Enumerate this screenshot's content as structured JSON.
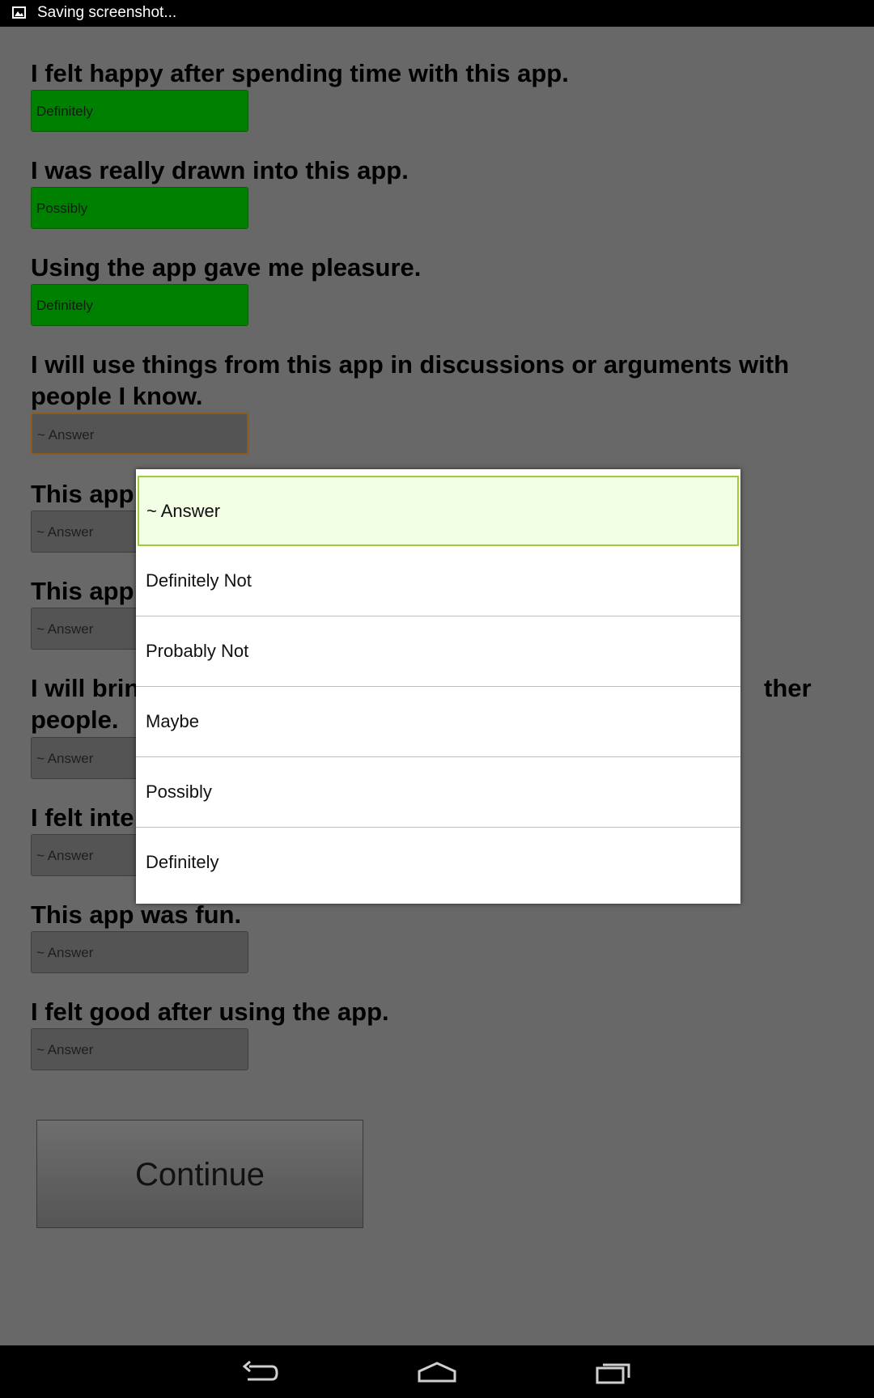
{
  "status_bar": {
    "notification_text": "Saving screenshot..."
  },
  "questions": [
    {
      "text": "I felt happy after spending time with this app.",
      "answer": "Definitely"
    },
    {
      "text": "I was really drawn into this app.",
      "answer": "Possibly"
    },
    {
      "text": "Using the app gave me pleasure.",
      "answer": "Definitely"
    },
    {
      "text": "I will use things from this app in discussions or arguments with people I know.",
      "answer": "~ Answer"
    },
    {
      "text": "This app",
      "answer": "~ Answer"
    },
    {
      "text": "This app",
      "answer": "~ Answer"
    },
    {
      "text_left": "I will brin",
      "text_right": "ther",
      "text_line2": "people.",
      "answer": "~ Answer"
    },
    {
      "text": "I felt inte",
      "answer": "~ Answer"
    },
    {
      "text": "This app was fun.",
      "answer": "~ Answer"
    },
    {
      "text": "I felt good after using the app.",
      "answer": "~ Answer"
    }
  ],
  "continue_label": "Continue",
  "dropdown": {
    "options": [
      "~ Answer",
      "Definitely Not",
      "Probably Not",
      "Maybe",
      "Possibly",
      "Definitely"
    ],
    "selected_index": 0
  },
  "colors": {
    "answered": "#008000",
    "unanswered": "#545454",
    "selected_option_bg": "#f3ffe4",
    "selected_option_border": "#a2cb3c"
  },
  "nav_icons": [
    "back-icon",
    "home-icon",
    "recents-icon"
  ]
}
